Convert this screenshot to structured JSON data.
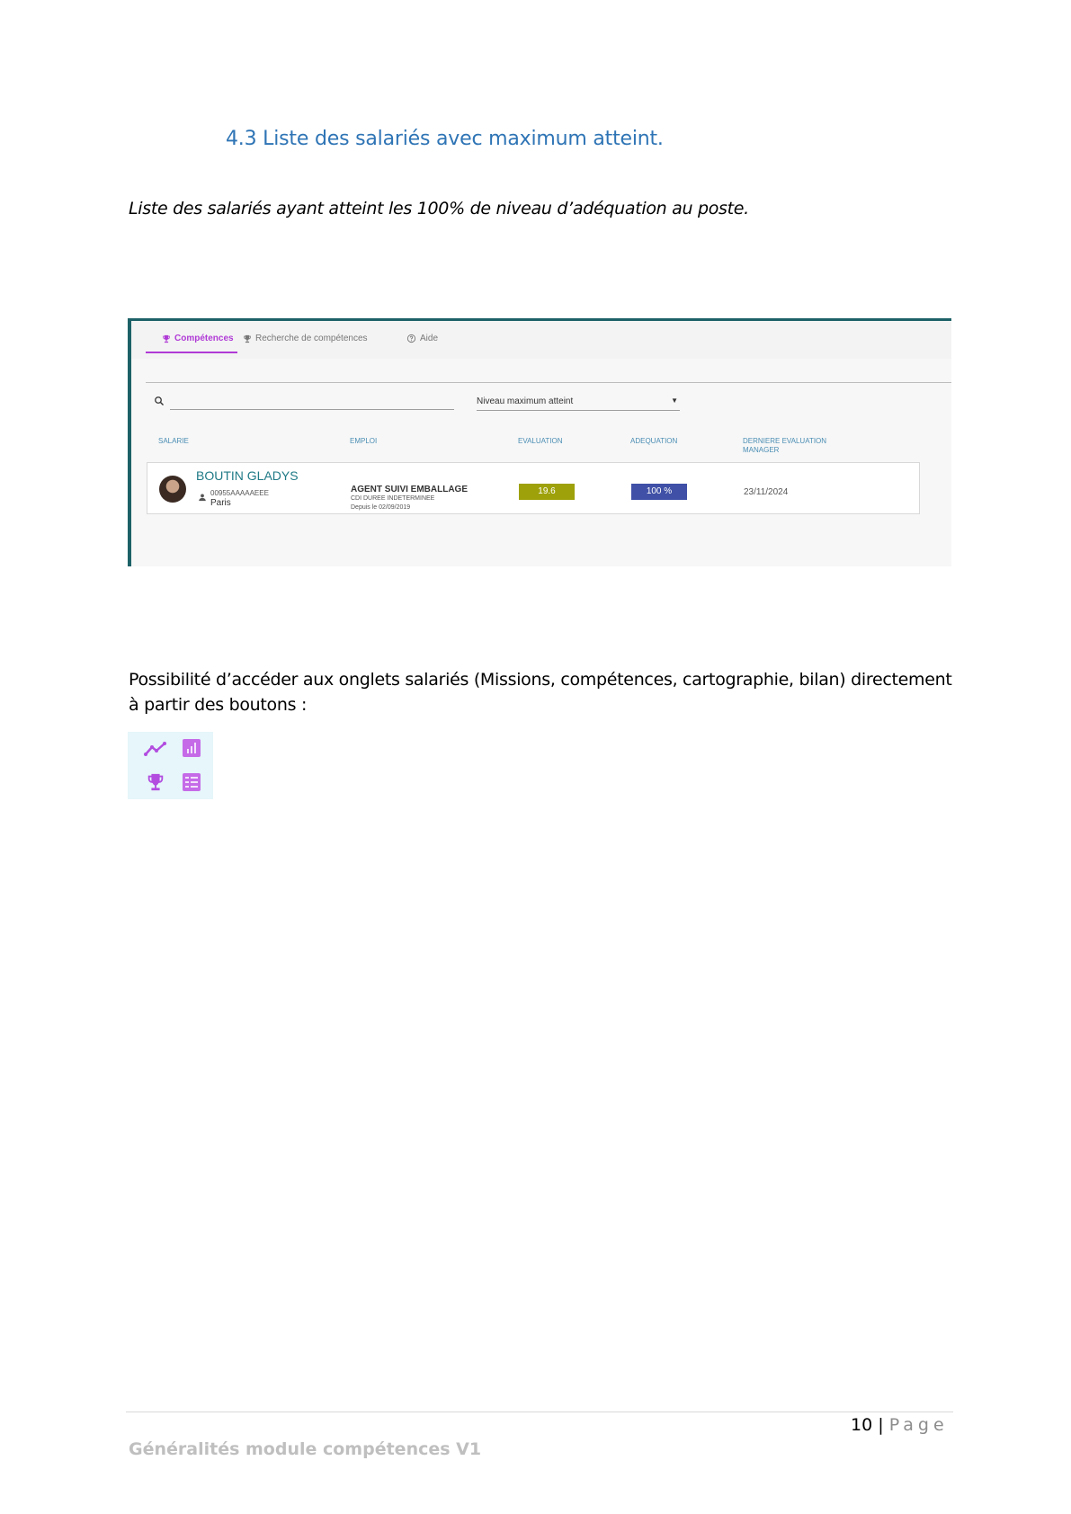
{
  "heading": "4.3 Liste des salariés avec maximum atteint.",
  "intro": "Liste des salariés ayant atteint les 100% de niveau d’adéquation au poste.",
  "screenshot": {
    "tabs": [
      {
        "label": "Compétences",
        "icon": "trophy-icon",
        "active": true
      },
      {
        "label": "Recherche de compétences",
        "icon": "trophy-icon",
        "active": false
      },
      {
        "label": "Aide",
        "icon": "help-circle-icon",
        "active": false
      }
    ],
    "search_placeholder": "",
    "filter_value": "Niveau maximum atteint",
    "columns": [
      "SALARIE",
      "EMPLOI",
      "EVALUATION",
      "ADEQUATION",
      "DERNIERE EVALUATION MANAGER"
    ],
    "rows": [
      {
        "name": "BOUTIN GLADYS",
        "id": "00955AAAAAEEE",
        "city": "Paris",
        "job_title": "AGENT SUIVI EMBALLAGE",
        "contract": "CDI DUREE INDETERMINEE",
        "since": "Depuis le 02/09/2019",
        "evaluation": "19.6",
        "adequation": "100 %",
        "last_eval": "23/11/2024"
      }
    ],
    "colors": {
      "accent": "#b03ad6",
      "frame": "#1c6167",
      "evaluation": "#9ea10a",
      "adequation": "#3f50a6"
    }
  },
  "paragraph": "Possibilité d’accéder aux onglets salariés (Missions, compétences, cartographie, bilan) directement à partir des boutons :",
  "buttons": [
    {
      "icon": "trend-line-icon"
    },
    {
      "icon": "bar-chart-icon"
    },
    {
      "icon": "trophy-icon"
    },
    {
      "icon": "table-icon"
    }
  ],
  "footer": {
    "page_number": "10",
    "separator": "|",
    "page_label": "Page",
    "doc_title": "Généralités module compétences V1"
  }
}
